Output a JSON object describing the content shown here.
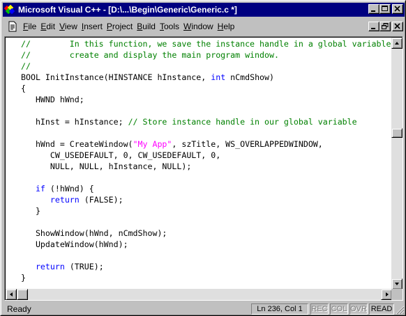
{
  "window": {
    "title": "Microsoft Visual C++ - [D:\\...\\Begin\\Generic\\Generic.c *]"
  },
  "menu": {
    "items": [
      "File",
      "Edit",
      "View",
      "Insert",
      "Project",
      "Build",
      "Tools",
      "Window",
      "Help"
    ],
    "underline": [
      "F",
      "E",
      "V",
      "I",
      "P",
      "B",
      "T",
      "W",
      "H"
    ]
  },
  "code": {
    "lines": [
      [
        [
          "c",
          "//        In this function, we save the instance handle in a global variable and"
        ]
      ],
      [
        [
          "c",
          "//        create and display the main program window."
        ]
      ],
      [
        [
          "c",
          "//"
        ]
      ],
      [
        [
          "n",
          "BOOL InitInstance(HINSTANCE hInstance, "
        ],
        [
          "k",
          "int"
        ],
        [
          "n",
          " nCmdShow)"
        ]
      ],
      [
        [
          "n",
          "{"
        ]
      ],
      [
        [
          "n",
          "   HWND hWnd;"
        ]
      ],
      [
        [
          "n",
          ""
        ]
      ],
      [
        [
          "n",
          "   hInst = hInstance; "
        ],
        [
          "c",
          "// Store instance handle in our global variable"
        ]
      ],
      [
        [
          "n",
          ""
        ]
      ],
      [
        [
          "n",
          "   hWnd = CreateWindow("
        ],
        [
          "s",
          "\"My App\""
        ],
        [
          "n",
          ", szTitle, WS_OVERLAPPEDWINDOW,"
        ]
      ],
      [
        [
          "n",
          "      CW_USEDEFAULT, 0, CW_USEDEFAULT, 0,"
        ]
      ],
      [
        [
          "n",
          "      NULL, NULL, hInstance, NULL);"
        ]
      ],
      [
        [
          "n",
          ""
        ]
      ],
      [
        [
          "n",
          "   "
        ],
        [
          "k",
          "if"
        ],
        [
          "n",
          " (!hWnd) {"
        ]
      ],
      [
        [
          "n",
          "      "
        ],
        [
          "k",
          "return"
        ],
        [
          "n",
          " (FALSE);"
        ]
      ],
      [
        [
          "n",
          "   }"
        ]
      ],
      [
        [
          "n",
          ""
        ]
      ],
      [
        [
          "n",
          "   ShowWindow(hWnd, nCmdShow);"
        ]
      ],
      [
        [
          "n",
          "   UpdateWindow(hWnd);"
        ]
      ],
      [
        [
          "n",
          ""
        ]
      ],
      [
        [
          "n",
          "   "
        ],
        [
          "k",
          "return"
        ],
        [
          "n",
          " (TRUE);"
        ]
      ],
      [
        [
          "n",
          "}"
        ]
      ]
    ]
  },
  "status": {
    "text": "Ready",
    "position": "Ln 236, Col 1",
    "indicators": [
      "REC",
      "COL",
      "OVR",
      "READ"
    ],
    "active": [
      false,
      false,
      false,
      true
    ]
  },
  "colors": {
    "titlebar": "#000080",
    "comment": "#008000",
    "keyword": "#0000ff",
    "string": "#ff00ff"
  },
  "icons": {
    "app": "visual-cpp-app-icon",
    "document": "source-file-icon",
    "minimize": "minimize-icon",
    "maximize": "maximize-icon",
    "restore": "restore-icon",
    "close": "close-icon"
  }
}
